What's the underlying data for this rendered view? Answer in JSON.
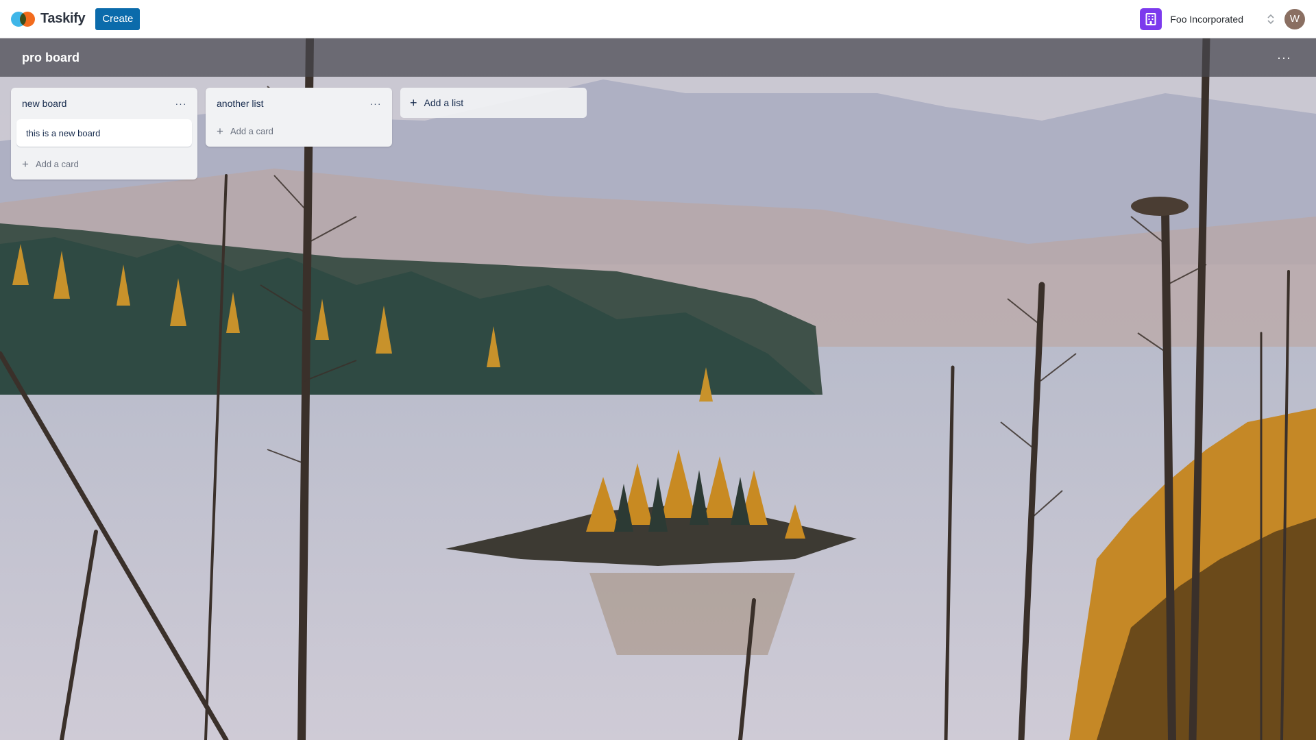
{
  "app": {
    "name": "Taskify",
    "create_label": "Create"
  },
  "org": {
    "name": "Foo Incorporated",
    "icon": "building-icon",
    "icon_color": "#7c3aed"
  },
  "user": {
    "avatar_initial": "W"
  },
  "board": {
    "title": "pro board",
    "menu_icon": "more-horizontal-icon"
  },
  "lists": [
    {
      "title": "new board",
      "cards": [
        {
          "title": "this is a new board"
        }
      ],
      "add_card_label": "Add a card"
    },
    {
      "title": "another list",
      "cards": [],
      "add_card_label": "Add a card"
    }
  ],
  "add_list_label": "Add a list",
  "colors": {
    "brand_blue": "#0b6bab",
    "logo_blue": "#3fb6e8",
    "logo_orange": "#f26b1d"
  }
}
